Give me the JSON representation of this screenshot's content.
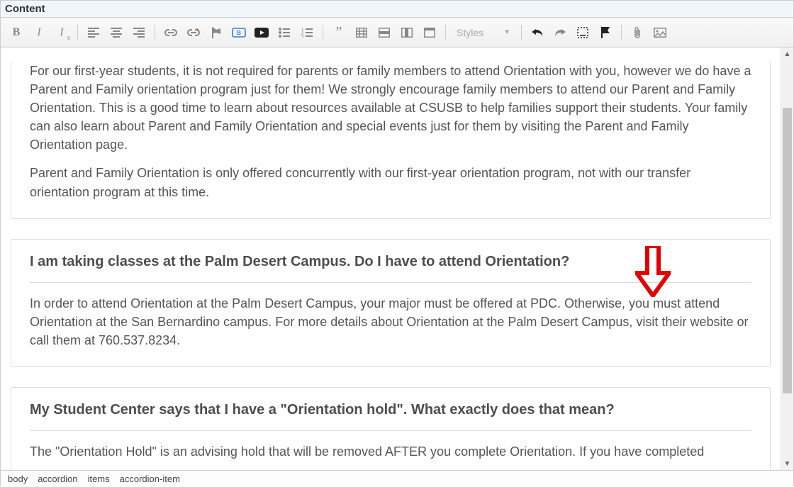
{
  "header": {
    "label": "Content"
  },
  "toolbar": {
    "styles_label": "Styles",
    "icons": {
      "bold": "bold-icon",
      "italic": "italic-icon",
      "remove_format": "remove-format-icon",
      "align_left": "align-left-icon",
      "align_center": "align-center-icon",
      "align_right": "align-right-icon",
      "link": "link-icon",
      "unlink": "unlink-icon",
      "flag": "flag-icon",
      "button": "button-icon",
      "youtube": "youtube-icon",
      "ul": "bulleted-list-icon",
      "ol": "numbered-list-icon",
      "quote": "blockquote-icon",
      "table": "table-icon",
      "row": "table-row-icon",
      "col": "table-column-icon",
      "th": "table-header-icon",
      "undo": "undo-icon",
      "redo": "redo-icon",
      "snippet": "template-icon",
      "flag2": "flag-solid-icon",
      "attach": "attachment-icon",
      "image": "image-icon"
    }
  },
  "content": {
    "card1": {
      "p1": "For our first-year students, it is not required for parents or family members to attend Orientation with you, however we do have a Parent and Family orientation program just for them! We strongly encourage family members to attend our Parent and Family Orientation. This is a good time to learn about resources available at CSUSB to help families support their students. Your family can also learn about Parent and Family Orientation and special events just for them by visiting the Parent and Family Orientation page.",
      "p2": "Parent and Family Orientation is only offered concurrently with our first-year orientation program, not with our transfer orientation program at this time."
    },
    "card2": {
      "title": "I am taking classes at the Palm Desert Campus. Do I have to attend Orientation?",
      "p1": "In order to attend Orientation at the Palm Desert Campus, your major must be offered at PDC. Otherwise, you must attend Orientation at the San Bernardino campus. For more details about Orientation at the Palm Desert Campus, visit their website or call them at 760.537.8234."
    },
    "card3": {
      "title": "My Student Center says that I have a \"Orientation hold\". What exactly does that mean?",
      "p1": "The \"Orientation Hold\" is an advising hold that will be removed AFTER you complete Orientation. If you have completed"
    }
  },
  "breadcrumb": [
    "body",
    "accordion",
    "items",
    "accordion-item"
  ]
}
